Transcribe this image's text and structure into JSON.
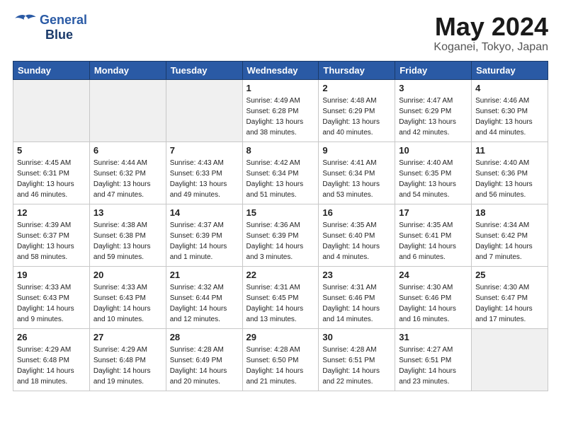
{
  "header": {
    "logo_line1": "General",
    "logo_line2": "Blue",
    "title": "May 2024",
    "location": "Koganei, Tokyo, Japan"
  },
  "weekdays": [
    "Sunday",
    "Monday",
    "Tuesday",
    "Wednesday",
    "Thursday",
    "Friday",
    "Saturday"
  ],
  "weeks": [
    [
      {
        "day": "",
        "empty": true
      },
      {
        "day": "",
        "empty": true
      },
      {
        "day": "",
        "empty": true
      },
      {
        "day": "1",
        "rise": "4:49 AM",
        "set": "6:28 PM",
        "daylight": "13 hours and 38 minutes."
      },
      {
        "day": "2",
        "rise": "4:48 AM",
        "set": "6:29 PM",
        "daylight": "13 hours and 40 minutes."
      },
      {
        "day": "3",
        "rise": "4:47 AM",
        "set": "6:29 PM",
        "daylight": "13 hours and 42 minutes."
      },
      {
        "day": "4",
        "rise": "4:46 AM",
        "set": "6:30 PM",
        "daylight": "13 hours and 44 minutes."
      }
    ],
    [
      {
        "day": "5",
        "rise": "4:45 AM",
        "set": "6:31 PM",
        "daylight": "13 hours and 46 minutes."
      },
      {
        "day": "6",
        "rise": "4:44 AM",
        "set": "6:32 PM",
        "daylight": "13 hours and 47 minutes."
      },
      {
        "day": "7",
        "rise": "4:43 AM",
        "set": "6:33 PM",
        "daylight": "13 hours and 49 minutes."
      },
      {
        "day": "8",
        "rise": "4:42 AM",
        "set": "6:34 PM",
        "daylight": "13 hours and 51 minutes."
      },
      {
        "day": "9",
        "rise": "4:41 AM",
        "set": "6:34 PM",
        "daylight": "13 hours and 53 minutes."
      },
      {
        "day": "10",
        "rise": "4:40 AM",
        "set": "6:35 PM",
        "daylight": "13 hours and 54 minutes."
      },
      {
        "day": "11",
        "rise": "4:40 AM",
        "set": "6:36 PM",
        "daylight": "13 hours and 56 minutes."
      }
    ],
    [
      {
        "day": "12",
        "rise": "4:39 AM",
        "set": "6:37 PM",
        "daylight": "13 hours and 58 minutes."
      },
      {
        "day": "13",
        "rise": "4:38 AM",
        "set": "6:38 PM",
        "daylight": "13 hours and 59 minutes."
      },
      {
        "day": "14",
        "rise": "4:37 AM",
        "set": "6:39 PM",
        "daylight": "14 hours and 1 minute."
      },
      {
        "day": "15",
        "rise": "4:36 AM",
        "set": "6:39 PM",
        "daylight": "14 hours and 3 minutes."
      },
      {
        "day": "16",
        "rise": "4:35 AM",
        "set": "6:40 PM",
        "daylight": "14 hours and 4 minutes."
      },
      {
        "day": "17",
        "rise": "4:35 AM",
        "set": "6:41 PM",
        "daylight": "14 hours and 6 minutes."
      },
      {
        "day": "18",
        "rise": "4:34 AM",
        "set": "6:42 PM",
        "daylight": "14 hours and 7 minutes."
      }
    ],
    [
      {
        "day": "19",
        "rise": "4:33 AM",
        "set": "6:43 PM",
        "daylight": "14 hours and 9 minutes."
      },
      {
        "day": "20",
        "rise": "4:33 AM",
        "set": "6:43 PM",
        "daylight": "14 hours and 10 minutes."
      },
      {
        "day": "21",
        "rise": "4:32 AM",
        "set": "6:44 PM",
        "daylight": "14 hours and 12 minutes."
      },
      {
        "day": "22",
        "rise": "4:31 AM",
        "set": "6:45 PM",
        "daylight": "14 hours and 13 minutes."
      },
      {
        "day": "23",
        "rise": "4:31 AM",
        "set": "6:46 PM",
        "daylight": "14 hours and 14 minutes."
      },
      {
        "day": "24",
        "rise": "4:30 AM",
        "set": "6:46 PM",
        "daylight": "14 hours and 16 minutes."
      },
      {
        "day": "25",
        "rise": "4:30 AM",
        "set": "6:47 PM",
        "daylight": "14 hours and 17 minutes."
      }
    ],
    [
      {
        "day": "26",
        "rise": "4:29 AM",
        "set": "6:48 PM",
        "daylight": "14 hours and 18 minutes."
      },
      {
        "day": "27",
        "rise": "4:29 AM",
        "set": "6:48 PM",
        "daylight": "14 hours and 19 minutes."
      },
      {
        "day": "28",
        "rise": "4:28 AM",
        "set": "6:49 PM",
        "daylight": "14 hours and 20 minutes."
      },
      {
        "day": "29",
        "rise": "4:28 AM",
        "set": "6:50 PM",
        "daylight": "14 hours and 21 minutes."
      },
      {
        "day": "30",
        "rise": "4:28 AM",
        "set": "6:51 PM",
        "daylight": "14 hours and 22 minutes."
      },
      {
        "day": "31",
        "rise": "4:27 AM",
        "set": "6:51 PM",
        "daylight": "14 hours and 23 minutes."
      },
      {
        "day": "",
        "empty": true
      }
    ]
  ],
  "labels": {
    "sunrise": "Sunrise:",
    "sunset": "Sunset:",
    "daylight": "Daylight:"
  }
}
